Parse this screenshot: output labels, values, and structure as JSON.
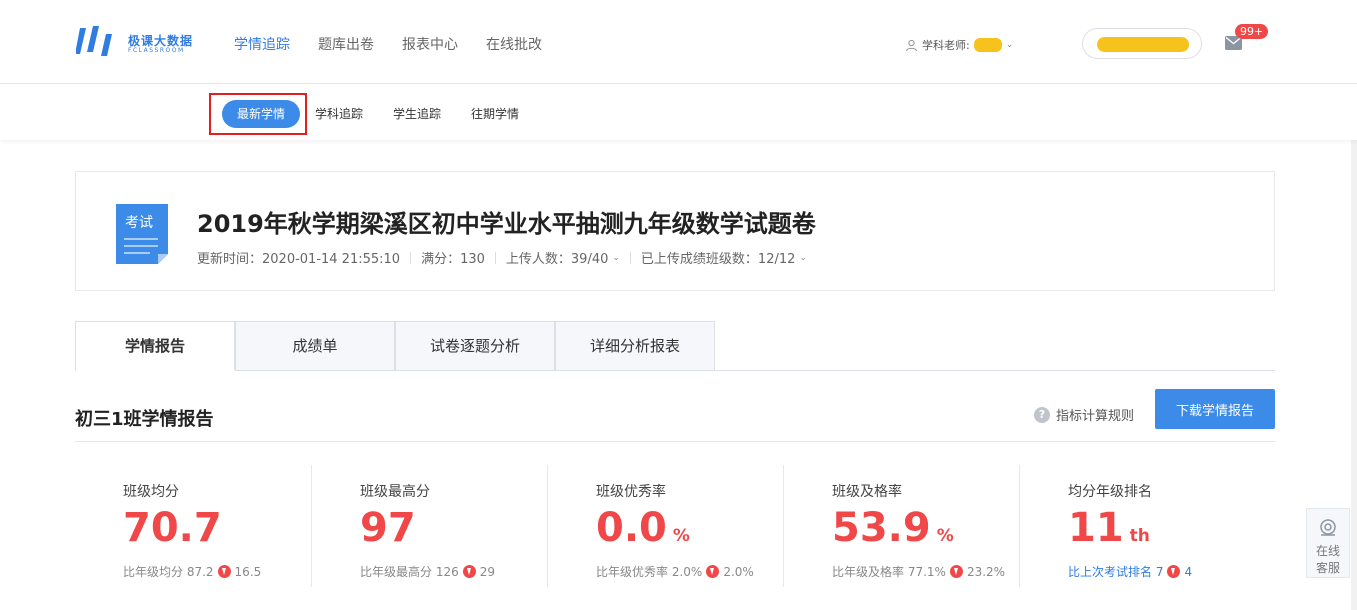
{
  "brand": {
    "name": "极课大数据",
    "sub": "FCLASSROOM"
  },
  "main_nav": [
    "学情追踪",
    "题库出卷",
    "报表中心",
    "在线批改"
  ],
  "teacher": {
    "label": "学科老师:"
  },
  "notifications": {
    "badge": "99+"
  },
  "sub_nav": [
    "最新学情",
    "学科追踪",
    "学生追踪",
    "往期学情"
  ],
  "exam": {
    "icon_label": "考试",
    "title": "2019年秋学期梁溪区初中学业水平抽测九年级数学试题卷",
    "updated": "更新时间：2020-01-14 21:55:10",
    "full_score": "满分：130",
    "uploaded": "上传人数：39/40",
    "classes": "已上传成绩班级数：12/12"
  },
  "tabs": [
    "学情报告",
    "成绩单",
    "试卷逐题分析",
    "详细分析报表"
  ],
  "report": {
    "title": "初三1班学情报告",
    "rule_link": "指标计算规则",
    "download": "下载学情报告"
  },
  "stats": [
    {
      "label": "班级均分",
      "value": "70.7",
      "unit": "",
      "cmp_text": "比年级均分 87.2",
      "cmp_delta": "16.5"
    },
    {
      "label": "班级最高分",
      "value": "97",
      "unit": "",
      "cmp_text": "比年级最高分 126",
      "cmp_delta": "29"
    },
    {
      "label": "班级优秀率",
      "value": "0.0",
      "unit": "%",
      "cmp_text": "比年级优秀率 2.0%",
      "cmp_delta": "2.0%"
    },
    {
      "label": "班级及格率",
      "value": "53.9",
      "unit": "%",
      "cmp_text": "比年级及格率 77.1%",
      "cmp_delta": "23.2%"
    },
    {
      "label": "均分年级排名",
      "value": "11",
      "unit": "th",
      "cmp_text": "比上次考试排名 7",
      "cmp_delta": "4"
    }
  ],
  "service": {
    "label1": "在线",
    "label2": "客服"
  },
  "colors": {
    "accent": "#3d8be8",
    "danger": "#f04848"
  }
}
